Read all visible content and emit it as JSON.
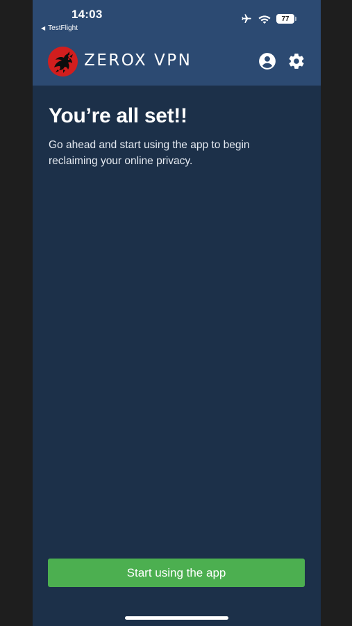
{
  "status_bar": {
    "time": "14:03",
    "back_app": "TestFlight",
    "battery": "77",
    "icons": [
      "airplane-icon",
      "wifi-icon",
      "battery-icon"
    ]
  },
  "header": {
    "brand": "ZEROX VPN",
    "logo": "dragon-logo",
    "icons": [
      "account-icon",
      "settings-icon"
    ]
  },
  "main": {
    "title": "You’re all set!!",
    "subtitle": "Go ahead and start using the app to begin reclaiming your online privacy."
  },
  "footer": {
    "start_label": "Start using the app"
  },
  "colors": {
    "header_bg": "#2c4a72",
    "page_bg": "#1c3049",
    "button": "#4caf50",
    "logo_red": "#d21e1e"
  }
}
